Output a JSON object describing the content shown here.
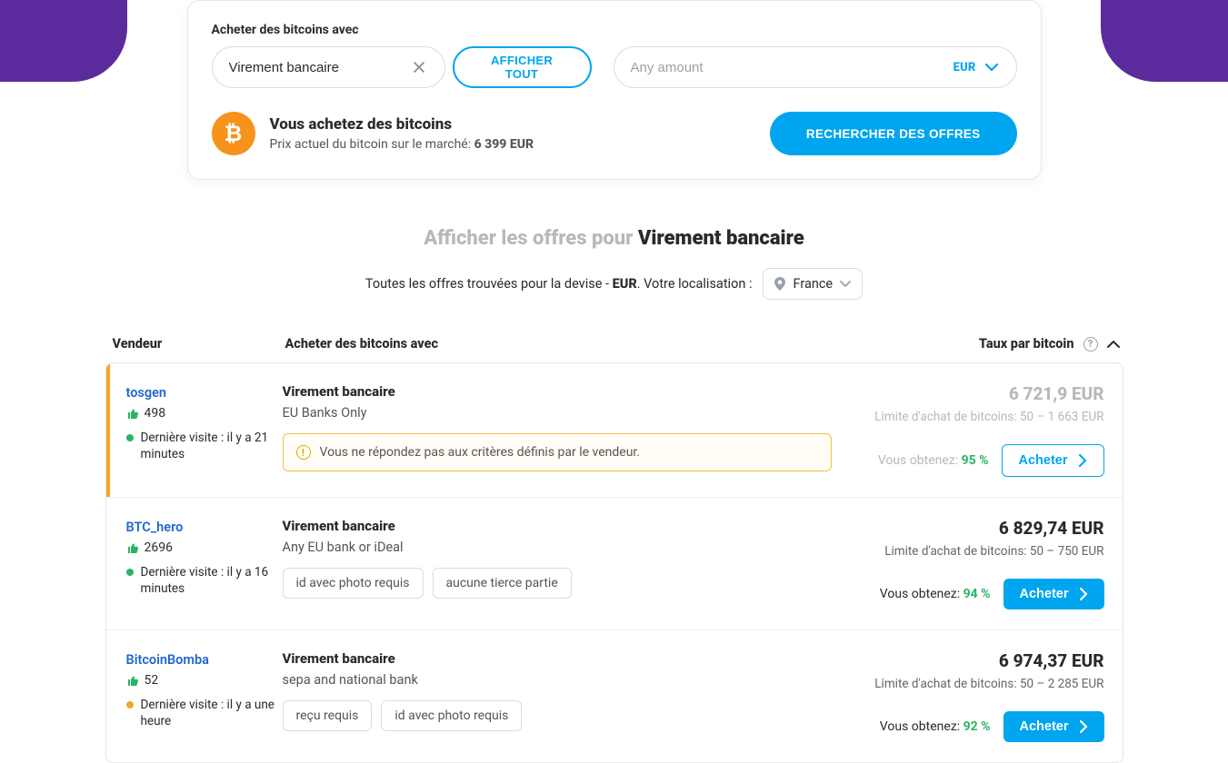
{
  "search": {
    "label": "Acheter des bitcoins avec",
    "method_value": "Virement bancaire",
    "show_all_label": "AFFICHER TOUT",
    "amount_placeholder": "Any amount",
    "currency_label": "EUR"
  },
  "buy_box": {
    "title": "Vous achetez des bitcoins",
    "subtitle_prefix": "Prix actuel du bitcoin sur le marché: ",
    "price": "6 399 EUR",
    "search_button": "RECHERCHER DES OFFRES"
  },
  "offers_heading": {
    "prefix": "Afficher les offres pour ",
    "method": "Virement bancaire"
  },
  "location_row": {
    "text_prefix": "Toutes les offres trouvées pour la devise - ",
    "currency": "EUR",
    "text_suffix": ". Votre localisation :",
    "location": "France"
  },
  "columns": {
    "vendor": "Vendeur",
    "method": "Acheter des bitcoins avec",
    "rate": "Taux par bitcoin"
  },
  "common": {
    "obtain_label": "Vous obtenez:",
    "limit_label": "Limite d'achat de bitcoins:",
    "last_visit_label": "Dernière visite :",
    "buy_label": "Acheter"
  },
  "offers": [
    {
      "vendor": "tosgen",
      "reputation": "498",
      "status_color": "green",
      "last_visit": "il y a 21 minutes",
      "method": "Virement bancaire",
      "method_detail": "EU Banks Only",
      "warning": "Vous ne répondez pas aux critères définis par le vendeur.",
      "tags": [],
      "rate": "6 721,9 EUR",
      "limit": "50 – 1 663 EUR",
      "obtain_pct": "95 %",
      "muted": true,
      "buy_style": "outline",
      "highlighted": true
    },
    {
      "vendor": "BTC_hero",
      "reputation": "2696",
      "status_color": "green",
      "last_visit": "il y a 16 minutes",
      "method": "Virement bancaire",
      "method_detail": "Any EU bank or iDeal",
      "warning": "",
      "tags": [
        "id avec photo requis",
        "aucune tierce partie"
      ],
      "rate": "6 829,74 EUR",
      "limit": "50 – 750 EUR",
      "obtain_pct": "94 %",
      "muted": false,
      "buy_style": "primary",
      "highlighted": false
    },
    {
      "vendor": "BitcoinBomba",
      "reputation": "52",
      "status_color": "orange",
      "last_visit": "il y a une heure",
      "method": "Virement bancaire",
      "method_detail": "sepa and national bank",
      "warning": "",
      "tags": [
        "reçu requis",
        "id avec photo requis"
      ],
      "rate": "6 974,37 EUR",
      "limit": "50 – 2 285 EUR",
      "obtain_pct": "92 %",
      "muted": false,
      "buy_style": "primary",
      "highlighted": false
    }
  ]
}
